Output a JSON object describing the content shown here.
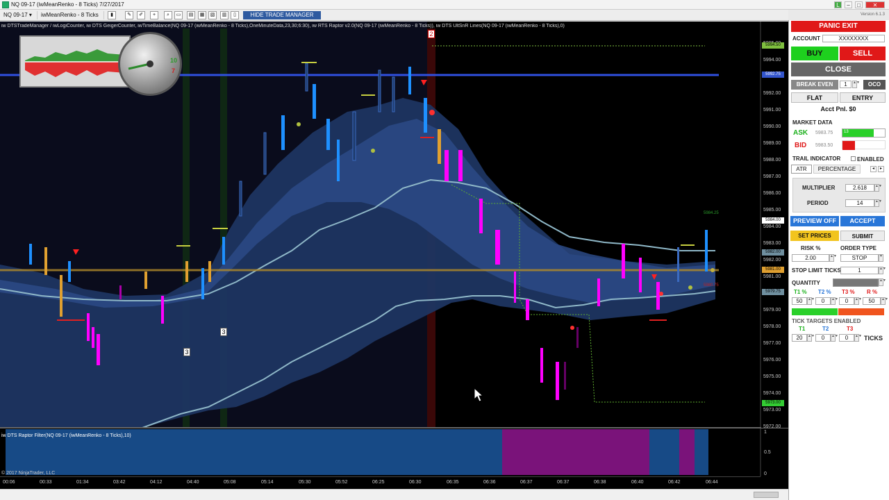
{
  "window": {
    "title": "NQ 09-17 (iwMeanRenko - 8 Ticks)  7/27/2017",
    "version": "Version 6.1.3",
    "controls": [
      "L",
      "–",
      "□",
      "✕"
    ]
  },
  "toolbar": {
    "instrument": "NQ 09-17",
    "bars_type": "iwMeanRenko - 8 Ticks",
    "hide_trade_manager": "HIDE TRADE MANAGER"
  },
  "chart": {
    "indicator_header": "iw DTSTradeManager / iwLogiCounter, iw DTS GeigerCounter, iwTimeBalance(NQ 09-17 (iwMeanRenko - 8 Ticks),OneMinuteData,23,30;6:30), iw RTS Raptor v2.0(NQ 09-17 (iwMeanRenko - 8 Ticks)), iw DTS UltSnR Lines(NQ 09-17 (iwMeanRenko - 8 Ticks),0)",
    "copyright": "© 2017 NinjaTrader, LLC",
    "subpanel_label": "iw DTS Raptor Filter(NQ 09-17 (iwMeanRenko - 8 Ticks),10)",
    "price_ticks": [
      "5995.00",
      "5994.00",
      "5993.00",
      "5992.00",
      "5991.00",
      "5990.00",
      "5989.00",
      "5988.00",
      "5987.00",
      "5986.00",
      "5985.00",
      "5984.00",
      "5983.00",
      "5982.00",
      "5981.00",
      "5980.00",
      "5979.00",
      "5978.00",
      "5977.00",
      "5976.00",
      "5975.00",
      "5974.00",
      "5973.00",
      "5972.00"
    ],
    "price_badges": [
      {
        "value": "5994.50",
        "color": "#7fbf3f"
      },
      {
        "value": "5992.75",
        "color": "#3355cc"
      },
      {
        "value": "5984.00",
        "color": "#ffffff"
      },
      {
        "value": "5982.00",
        "color": "#6f8f9f"
      },
      {
        "value": "5981.00",
        "color": "#e0a030"
      },
      {
        "value": "5979.75",
        "color": "#6f8f9f"
      },
      {
        "value": "5973.00",
        "color": "#33cc33"
      }
    ],
    "side_labels": {
      "high": "5984.25",
      "low": "5980.75"
    },
    "subpanel_ticks": [
      "1",
      "0.5",
      "0"
    ],
    "time_ticks": [
      "00:06",
      "00:33",
      "01:34",
      "03:42",
      "04:12",
      "04:40",
      "05:08",
      "05:14",
      "05:30",
      "05:52",
      "06:25",
      "06:30",
      "06:35",
      "06:36",
      "06:37",
      "06:37",
      "06:38",
      "06:40",
      "06:42",
      "06:44"
    ],
    "box_labels": [
      "2",
      "3",
      "3"
    ],
    "gauge": {
      "high": "10",
      "low": "7"
    },
    "colors": {
      "up_bar": "#1e90ff",
      "down_bar": "#ff00ff",
      "neutral_bar": "#e0a030",
      "channel_fill": "#1f3a66",
      "filter_blue": "#174a86",
      "filter_magenta": "#7a137a"
    }
  },
  "panel": {
    "panic_exit": "PANIC EXIT",
    "account_label": "ACCOUNT",
    "account_value": "XXXXXXXX",
    "buy": "BUY",
    "sell": "SELL",
    "close": "CLOSE",
    "break_even": "BREAK EVEN",
    "break_even_value": "1",
    "oco": "OCO",
    "flat": "FLAT",
    "entry": "ENTRY",
    "acct_pnl": "Acct Pnl. $0",
    "market_data": "MARKET DATA",
    "ask_label": "ASK",
    "ask_value": "5983.75",
    "ask_size": "13",
    "bid_label": "BID",
    "bid_value": "5983.50",
    "trail_indicator": "TRAIL INDICATOR",
    "enabled": "ENABLED",
    "tab_atr": "ATR",
    "tab_percentage": "PERCENTAGE",
    "multiplier_label": "MULTIPLIER",
    "multiplier_value": "2.618",
    "period_label": "PERIOD",
    "period_value": "14",
    "preview_off": "PREVIEW OFF",
    "accept": "ACCEPT",
    "set_prices": "SET PRICES",
    "submit": "SUBMIT",
    "risk_label": "RISK %",
    "risk_value": "2.00",
    "order_type_label": "ORDER TYPE",
    "order_type_value": "STOP",
    "stop_limit_label": "STOP LIMIT TICKS",
    "stop_limit_value": "1",
    "quantity_label": "QUANTITY",
    "pct_headers": [
      "T1 %",
      "T2 %",
      "T3 %",
      "R %"
    ],
    "pct_values": [
      "50",
      "0",
      "0",
      "50"
    ],
    "tick_targets": "TICK TARGETS ENABLED",
    "t_headers": [
      "T1",
      "T2",
      "T3"
    ],
    "t_values": [
      "20",
      "0",
      "0"
    ],
    "ticks": "TICKS"
  }
}
